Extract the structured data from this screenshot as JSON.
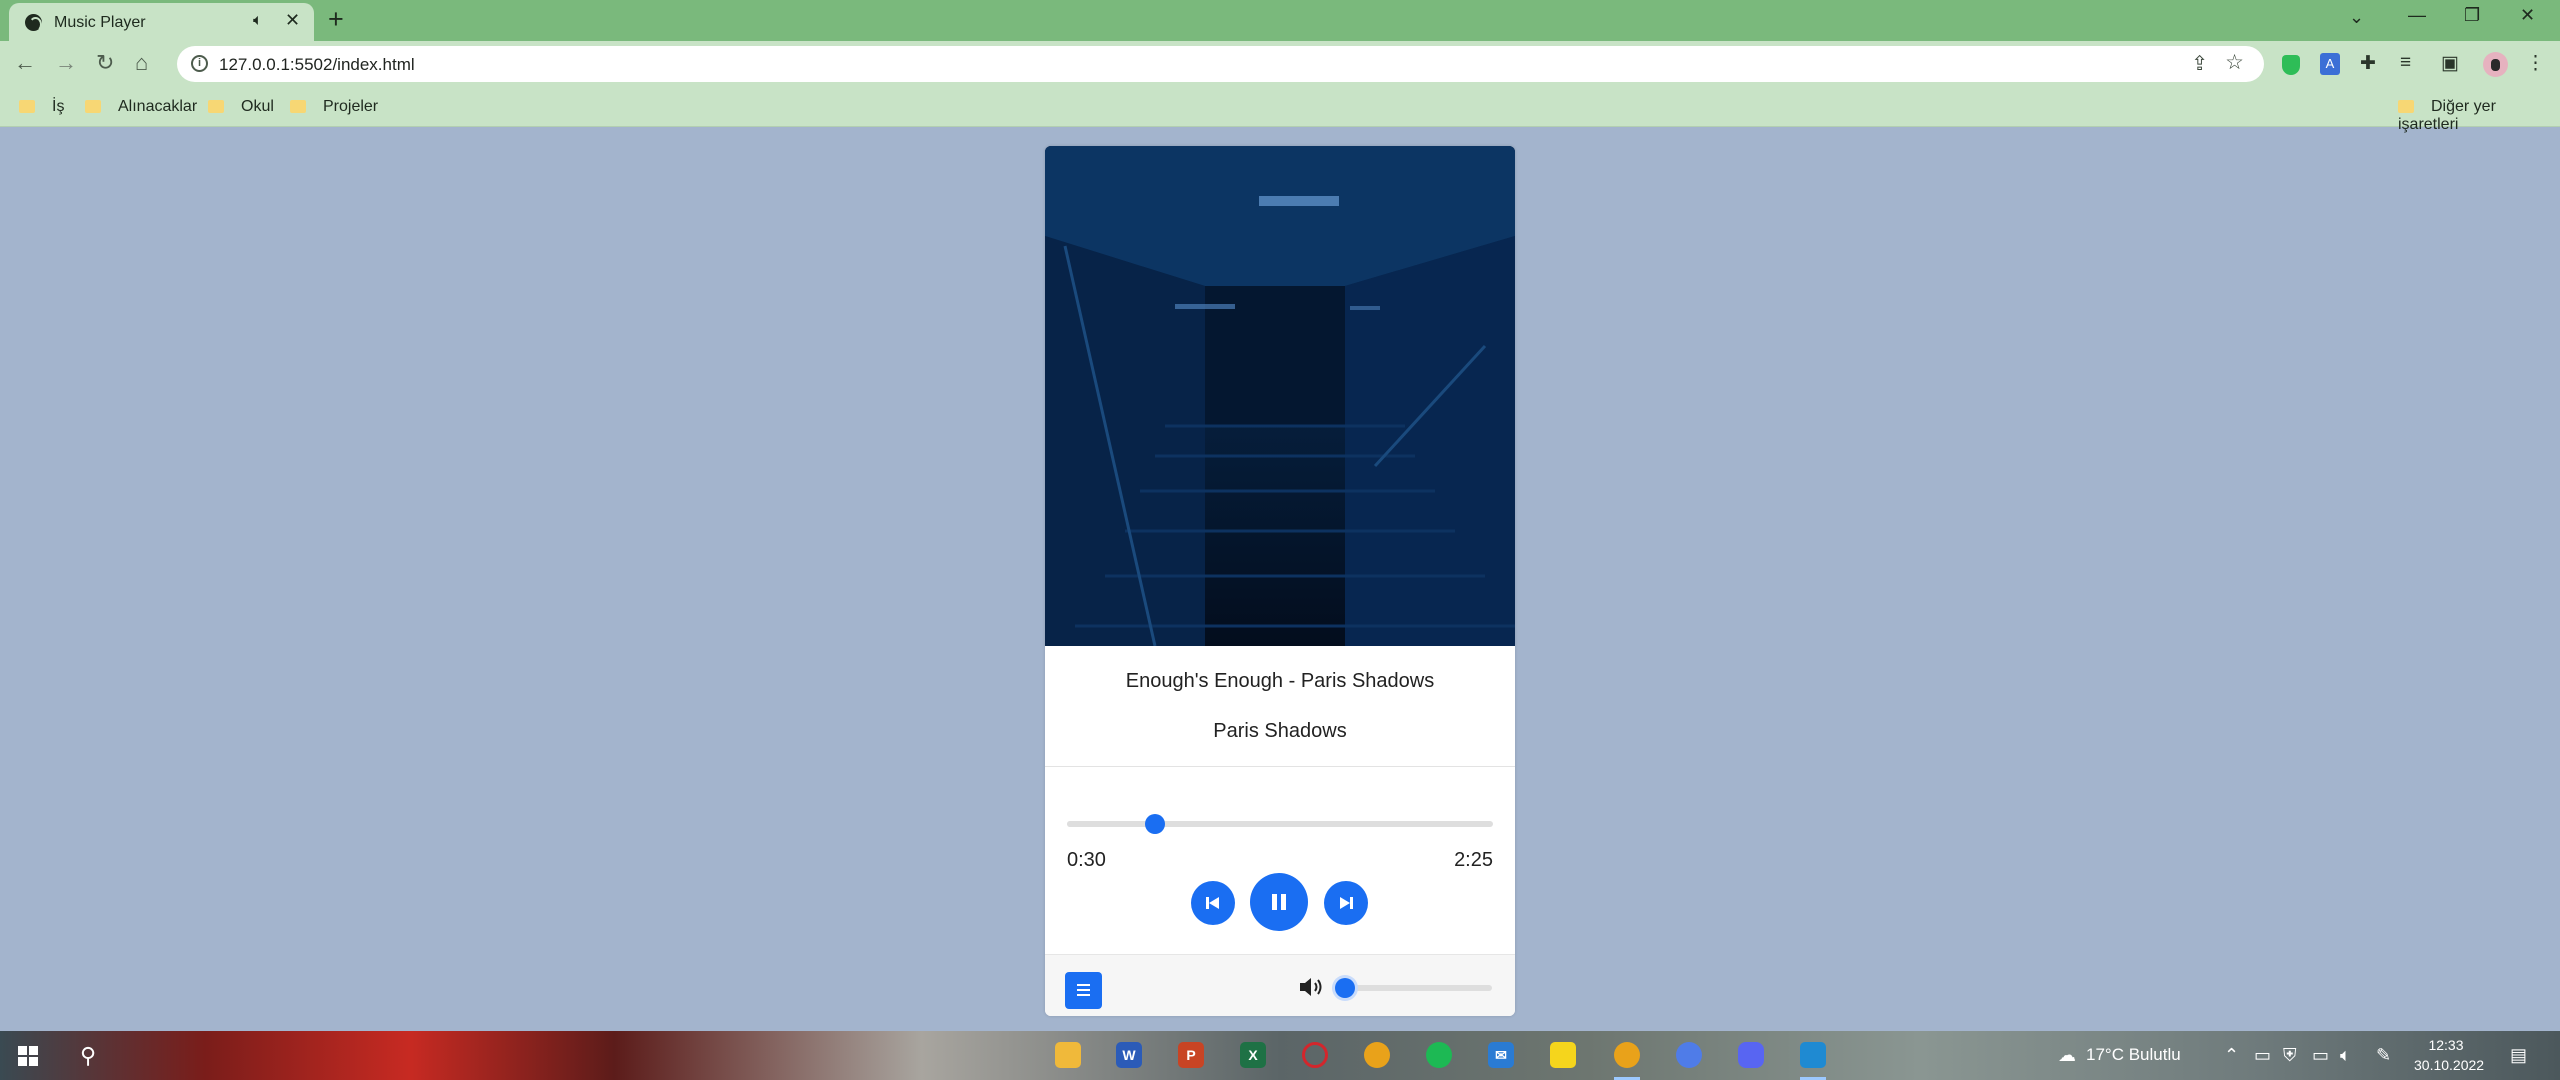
{
  "browser": {
    "tab_title": "Music Player",
    "url": "127.0.0.1:5502/index.html",
    "bookmarks": [
      "İş",
      "Alınacaklar",
      "Okul",
      "Projeler"
    ],
    "other_bookmarks": "Diğer yer işaretleri"
  },
  "player": {
    "song_title": "Enough's Enough - Paris Shadows",
    "artist": "Paris Shadows",
    "current_time": "0:30",
    "duration": "2:25",
    "progress_fraction": 0.207,
    "volume_fraction": 0.08,
    "is_playing": true,
    "accent_color": "#1a6ef2"
  },
  "taskbar": {
    "weather": "17°C  Bulutlu",
    "time": "12:33",
    "date": "30.10.2022"
  }
}
